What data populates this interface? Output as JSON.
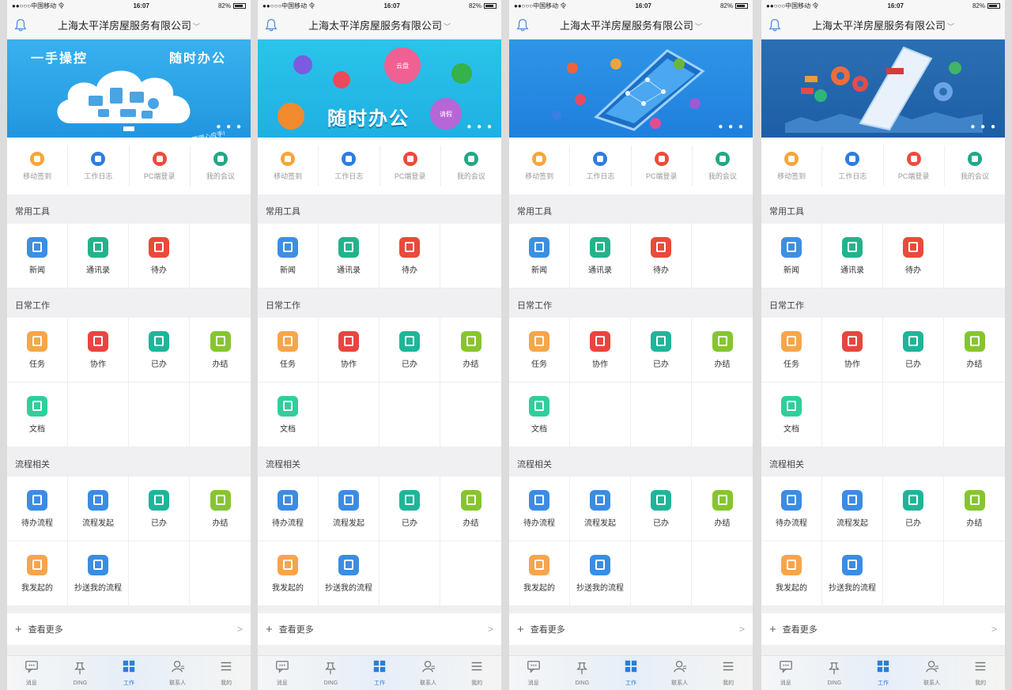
{
  "colors": {
    "accent": "#2a7fd6",
    "banner_blue": "#2aa5e6",
    "quick_orange": "#f7a53a",
    "quick_blue": "#2d7de0",
    "quick_red": "#ef4a3c",
    "quick_green": "#22a886",
    "tool_blue": "#3d8fe0",
    "tool_green": "#22b38c",
    "tool_red": "#ea4a3a",
    "work_orange": "#f6a64a",
    "work_red": "#e8453d",
    "work_teal": "#1fb59a",
    "work_lime": "#86c531",
    "work_mint": "#2fcf9c",
    "flow_blue": "#3c8ce3",
    "flow_orange": "#f5a54e"
  },
  "phones": [
    {
      "status": {
        "carrier": "●●○○○中国移动 令",
        "time": "16:07",
        "battery": "82%"
      },
      "title": "上海太平洋房屋服务有限公司",
      "banner": {
        "headline": "一手操控",
        "headline2": "随时办公",
        "slogan": "让工作更得心应手!",
        "style": "cloud"
      },
      "quick": [
        {
          "label": "移动签到"
        },
        {
          "label": "工作日志"
        },
        {
          "label": "PC端登录"
        },
        {
          "label": "我的会议"
        }
      ],
      "sections": [
        {
          "title": "常用工具",
          "items": [
            {
              "label": "新闻"
            },
            {
              "label": "通讯录"
            },
            {
              "label": "待办"
            }
          ]
        },
        {
          "title": "日常工作",
          "items": [
            {
              "label": "任务"
            },
            {
              "label": "协作"
            },
            {
              "label": "已办"
            },
            {
              "label": "办结"
            },
            {
              "label": "文档"
            }
          ]
        },
        {
          "title": "流程相关",
          "items": [
            {
              "label": "待办流程"
            },
            {
              "label": "流程发起"
            },
            {
              "label": "已办"
            },
            {
              "label": "办结"
            },
            {
              "label": "我发起的"
            },
            {
              "label": "抄送我的流程"
            }
          ]
        }
      ],
      "more": "查看更多",
      "tabs": [
        {
          "label": "消息"
        },
        {
          "label": "DING"
        },
        {
          "label": "工作"
        },
        {
          "label": "联系人"
        },
        {
          "label": "我的"
        }
      ]
    },
    {
      "status": {
        "carrier": "●●○○○中国移动 令",
        "time": "16:07",
        "battery": "82%"
      },
      "title": "上海太平洋房屋服务有限公司",
      "banner": {
        "headline": "随时办公",
        "sticker1": "云盘",
        "sticker2": "请假",
        "style": "party"
      },
      "quick": [
        {
          "label": "移动签到"
        },
        {
          "label": "工作日志"
        },
        {
          "label": "PC端登录"
        },
        {
          "label": "我的会议"
        }
      ],
      "sections": [
        {
          "title": "常用工具",
          "items": [
            {
              "label": "新闻"
            },
            {
              "label": "通讯录"
            },
            {
              "label": "待办"
            }
          ]
        },
        {
          "title": "日常工作",
          "items": [
            {
              "label": "任务"
            },
            {
              "label": "协作"
            },
            {
              "label": "已办"
            },
            {
              "label": "办结"
            },
            {
              "label": "文档"
            }
          ]
        },
        {
          "title": "流程相关",
          "items": [
            {
              "label": "待办流程"
            },
            {
              "label": "流程发起"
            },
            {
              "label": "已办"
            },
            {
              "label": "办结"
            },
            {
              "label": "我发起的"
            },
            {
              "label": "抄送我的流程"
            }
          ]
        }
      ],
      "more": "查看更多",
      "tabs": [
        {
          "label": "消息"
        },
        {
          "label": "DING"
        },
        {
          "label": "工作"
        },
        {
          "label": "联系人"
        },
        {
          "label": "我的"
        }
      ]
    },
    {
      "status": {
        "carrier": "●●○○○中国移动 令",
        "time": "16:07",
        "battery": "82%"
      },
      "title": "上海太平洋房屋服务有限公司",
      "banner": {
        "style": "phone"
      },
      "quick": [
        {
          "label": "移动签到"
        },
        {
          "label": "工作日志"
        },
        {
          "label": "PC端登录"
        },
        {
          "label": "我的会议"
        }
      ],
      "sections": [
        {
          "title": "常用工具",
          "items": [
            {
              "label": "新闻"
            },
            {
              "label": "通讯录"
            },
            {
              "label": "待办"
            }
          ]
        },
        {
          "title": "日常工作",
          "items": [
            {
              "label": "任务"
            },
            {
              "label": "协作"
            },
            {
              "label": "已办"
            },
            {
              "label": "办结"
            },
            {
              "label": "文档"
            }
          ]
        },
        {
          "title": "流程相关",
          "items": [
            {
              "label": "待办流程"
            },
            {
              "label": "流程发起"
            },
            {
              "label": "已办"
            },
            {
              "label": "办结"
            },
            {
              "label": "我发起的"
            },
            {
              "label": "抄送我的流程"
            }
          ]
        }
      ],
      "more": "查看更多",
      "tabs": [
        {
          "label": "消息"
        },
        {
          "label": "DING"
        },
        {
          "label": "工作"
        },
        {
          "label": "联系人"
        },
        {
          "label": "我的"
        }
      ]
    },
    {
      "status": {
        "carrier": "●●○○○中国移动 令",
        "time": "16:07",
        "battery": "82%"
      },
      "title": "上海太平洋房屋服务有限公司",
      "banner": {
        "style": "gears"
      },
      "quick": [
        {
          "label": "移动签到"
        },
        {
          "label": "工作日志"
        },
        {
          "label": "PC端登录"
        },
        {
          "label": "我的会议"
        }
      ],
      "sections": [
        {
          "title": "常用工具",
          "items": [
            {
              "label": "新闻"
            },
            {
              "label": "通讯录"
            },
            {
              "label": "待办"
            }
          ]
        },
        {
          "title": "日常工作",
          "items": [
            {
              "label": "任务"
            },
            {
              "label": "协作"
            },
            {
              "label": "已办"
            },
            {
              "label": "办结"
            },
            {
              "label": "文档"
            }
          ]
        },
        {
          "title": "流程相关",
          "items": [
            {
              "label": "待办流程"
            },
            {
              "label": "流程发起"
            },
            {
              "label": "已办"
            },
            {
              "label": "办结"
            },
            {
              "label": "我发起的"
            },
            {
              "label": "抄送我的流程"
            }
          ]
        }
      ],
      "more": "查看更多",
      "tabs": [
        {
          "label": "消息"
        },
        {
          "label": "DING"
        },
        {
          "label": "工作"
        },
        {
          "label": "联系人"
        },
        {
          "label": "我的"
        }
      ]
    }
  ]
}
